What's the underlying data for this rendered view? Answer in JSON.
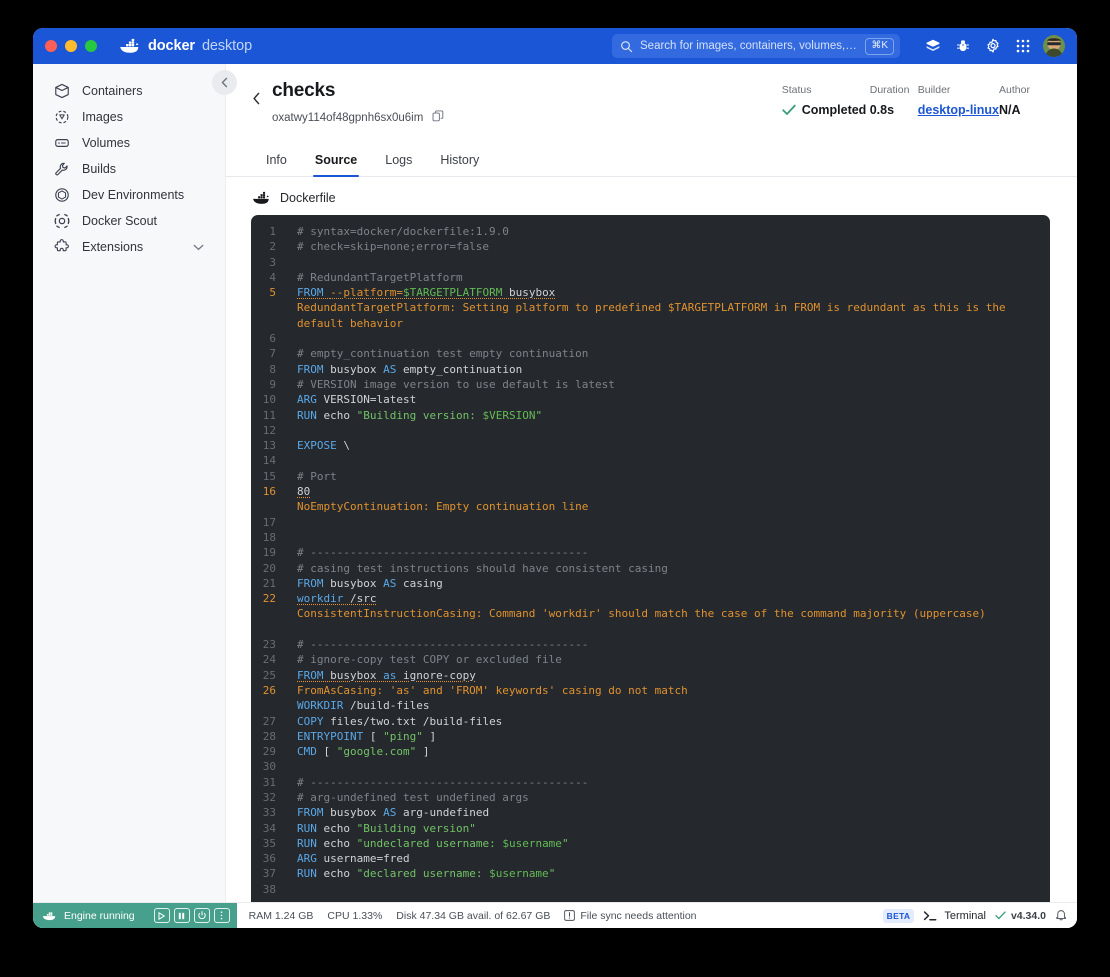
{
  "titlebar": {
    "brand_primary": "docker",
    "brand_secondary": "desktop",
    "search_placeholder": "Search for images, containers, volumes, extensi…",
    "search_shortcut": "⌘K",
    "icons": [
      "docker-scout-icon",
      "bug-icon",
      "gear-icon",
      "grid-apps-icon",
      "avatar"
    ]
  },
  "sidebar": {
    "items": [
      {
        "label": "Containers",
        "icon": "container-icon"
      },
      {
        "label": "Images",
        "icon": "image-icon"
      },
      {
        "label": "Volumes",
        "icon": "volume-icon"
      },
      {
        "label": "Builds",
        "icon": "wrench-icon"
      },
      {
        "label": "Dev Environments",
        "icon": "dev-env-icon"
      },
      {
        "label": "Docker Scout",
        "icon": "scout-icon"
      },
      {
        "label": "Extensions",
        "icon": "extensions-icon",
        "chevron": "chevron-down-icon"
      }
    ]
  },
  "header": {
    "title": "checks",
    "build_id": "oxatwy114of48gpnh6sx0u6im",
    "copy_icon": "copy-icon",
    "back_icon": "chevron-left-icon",
    "meta": [
      {
        "label": "Status",
        "value": "Completed",
        "icon": "check-icon"
      },
      {
        "label": "Duration",
        "value": "0.8s"
      },
      {
        "label": "Builder",
        "value": "desktop-linux",
        "link": true
      },
      {
        "label": "Author",
        "value": "N/A"
      }
    ]
  },
  "tabs": [
    {
      "label": "Info",
      "active": false
    },
    {
      "label": "Source",
      "active": true
    },
    {
      "label": "Logs",
      "active": false
    },
    {
      "label": "History",
      "active": false
    }
  ],
  "file": {
    "icon": "docker-whale-icon",
    "name": "Dockerfile"
  },
  "code": {
    "lines": [
      {
        "n": "1",
        "warn": false,
        "tokens": [
          {
            "t": "# syntax=docker/dockerfile:1.9.0",
            "c": "cmt"
          }
        ]
      },
      {
        "n": "2",
        "warn": false,
        "tokens": [
          {
            "t": "# check=skip=none;error=false",
            "c": "cmt"
          }
        ]
      },
      {
        "n": "3",
        "warn": false,
        "tokens": []
      },
      {
        "n": "4",
        "warn": false,
        "tokens": [
          {
            "t": "# RedundantTargetPlatform",
            "c": "cmt"
          }
        ]
      },
      {
        "n": "5",
        "warn": true,
        "squiggle": true,
        "tokens": [
          {
            "t": "FROM",
            "c": "kw"
          },
          {
            "t": " ",
            "c": "plain"
          },
          {
            "t": "--platform=",
            "c": "flag"
          },
          {
            "t": "$TARGETPLATFORM",
            "c": "var"
          },
          {
            "t": " busybox",
            "c": "plain"
          }
        ]
      },
      {
        "n": "",
        "warn": false,
        "diag": "RedundantTargetPlatform: Setting platform to predefined $TARGETPLATFORM in FROM is redundant as this is the default behavior"
      },
      {
        "n": "6",
        "warn": false,
        "tokens": []
      },
      {
        "n": "7",
        "warn": false,
        "tokens": [
          {
            "t": "# empty_continuation test empty continuation",
            "c": "cmt"
          }
        ]
      },
      {
        "n": "8",
        "warn": false,
        "tokens": [
          {
            "t": "FROM",
            "c": "kw"
          },
          {
            "t": " busybox ",
            "c": "plain"
          },
          {
            "t": "AS",
            "c": "kw"
          },
          {
            "t": " empty_continuation",
            "c": "plain"
          }
        ]
      },
      {
        "n": "9",
        "warn": false,
        "tokens": [
          {
            "t": "# VERSION image version to use default is latest",
            "c": "cmt"
          }
        ]
      },
      {
        "n": "10",
        "warn": false,
        "tokens": [
          {
            "t": "ARG",
            "c": "kw"
          },
          {
            "t": " VERSION=latest",
            "c": "plain"
          }
        ]
      },
      {
        "n": "11",
        "warn": false,
        "tokens": [
          {
            "t": "RUN",
            "c": "kw"
          },
          {
            "t": " echo ",
            "c": "plain"
          },
          {
            "t": "\"Building version: ",
            "c": "str"
          },
          {
            "t": "$VERSION",
            "c": "var"
          },
          {
            "t": "\"",
            "c": "str"
          }
        ]
      },
      {
        "n": "12",
        "warn": false,
        "tokens": []
      },
      {
        "n": "13",
        "warn": false,
        "tokens": [
          {
            "t": "EXPOSE",
            "c": "kw"
          },
          {
            "t": " \\",
            "c": "plain"
          }
        ]
      },
      {
        "n": "14",
        "warn": false,
        "tokens": []
      },
      {
        "n": "15",
        "warn": false,
        "tokens": [
          {
            "t": "# Port",
            "c": "cmt"
          }
        ]
      },
      {
        "n": "16",
        "warn": true,
        "squiggle": true,
        "tokens": [
          {
            "t": "80",
            "c": "plain"
          }
        ]
      },
      {
        "n": "",
        "warn": false,
        "diag": "NoEmptyContinuation: Empty continuation line"
      },
      {
        "n": "17",
        "warn": false,
        "tokens": []
      },
      {
        "n": "18",
        "warn": false,
        "tokens": []
      },
      {
        "n": "19",
        "warn": false,
        "tokens": [
          {
            "t": "# ------------------------------------------",
            "c": "cmt"
          }
        ]
      },
      {
        "n": "20",
        "warn": false,
        "tokens": [
          {
            "t": "# casing test instructions should have consistent casing",
            "c": "cmt"
          }
        ]
      },
      {
        "n": "21",
        "warn": false,
        "tokens": [
          {
            "t": "FROM",
            "c": "kw"
          },
          {
            "t": " busybox ",
            "c": "plain"
          },
          {
            "t": "AS",
            "c": "kw"
          },
          {
            "t": " casing",
            "c": "plain"
          }
        ]
      },
      {
        "n": "22",
        "warn": true,
        "squiggle": true,
        "tokens": [
          {
            "t": "workdir",
            "c": "kw"
          },
          {
            "t": " /src",
            "c": "plain"
          }
        ]
      },
      {
        "n": "",
        "warn": false,
        "diag": "ConsistentInstructionCasing: Command 'workdir' should match the case of the command majority (uppercase)"
      },
      {
        "n": "23",
        "warn": false,
        "tokens": []
      },
      {
        "n": "24",
        "warn": false,
        "tokens": [
          {
            "t": "# ------------------------------------------",
            "c": "cmt"
          }
        ]
      },
      {
        "n": "25",
        "warn": false,
        "tokens": [
          {
            "t": "# ignore-copy test COPY or excluded file",
            "c": "cmt"
          }
        ]
      },
      {
        "n": "26",
        "warn": true,
        "squiggle": true,
        "tokens": [
          {
            "t": "FROM",
            "c": "kw"
          },
          {
            "t": " busybox ",
            "c": "plain"
          },
          {
            "t": "as",
            "c": "kw"
          },
          {
            "t": " ignore-copy",
            "c": "plain"
          }
        ]
      },
      {
        "n": "",
        "warn": false,
        "diag": "FromAsCasing: 'as' and 'FROM' keywords' casing do not match"
      },
      {
        "n": "27",
        "warn": false,
        "tokens": [
          {
            "t": "WORKDIR",
            "c": "kw"
          },
          {
            "t": " /build-files",
            "c": "plain"
          }
        ]
      },
      {
        "n": "28",
        "warn": false,
        "tokens": [
          {
            "t": "COPY",
            "c": "kw"
          },
          {
            "t": " files/two.txt /build-files",
            "c": "plain"
          }
        ]
      },
      {
        "n": "29",
        "warn": false,
        "tokens": [
          {
            "t": "ENTRYPOINT",
            "c": "kw"
          },
          {
            "t": " [ ",
            "c": "plain"
          },
          {
            "t": "\"ping\"",
            "c": "str"
          },
          {
            "t": " ]",
            "c": "plain"
          }
        ]
      },
      {
        "n": "30",
        "warn": false,
        "tokens": [
          {
            "t": "CMD",
            "c": "kw"
          },
          {
            "t": " [ ",
            "c": "plain"
          },
          {
            "t": "\"google.com\"",
            "c": "str"
          },
          {
            "t": " ]",
            "c": "plain"
          }
        ]
      },
      {
        "n": "31",
        "warn": false,
        "tokens": []
      },
      {
        "n": "32",
        "warn": false,
        "tokens": [
          {
            "t": "# ------------------------------------------",
            "c": "cmt"
          }
        ]
      },
      {
        "n": "33",
        "warn": false,
        "tokens": [
          {
            "t": "# arg-undefined test undefined args",
            "c": "cmt"
          }
        ]
      },
      {
        "n": "34",
        "warn": false,
        "tokens": [
          {
            "t": "FROM",
            "c": "kw"
          },
          {
            "t": " busybox ",
            "c": "plain"
          },
          {
            "t": "AS",
            "c": "kw"
          },
          {
            "t": " arg-undefined",
            "c": "plain"
          }
        ]
      },
      {
        "n": "35",
        "warn": false,
        "tokens": [
          {
            "t": "RUN",
            "c": "kw"
          },
          {
            "t": " echo ",
            "c": "plain"
          },
          {
            "t": "\"Building version\"",
            "c": "str"
          }
        ]
      },
      {
        "n": "36",
        "warn": false,
        "tokens": [
          {
            "t": "RUN",
            "c": "kw"
          },
          {
            "t": " echo ",
            "c": "plain"
          },
          {
            "t": "\"undeclared username: ",
            "c": "str"
          },
          {
            "t": "$username",
            "c": "var"
          },
          {
            "t": "\"",
            "c": "str"
          }
        ]
      },
      {
        "n": "37",
        "warn": false,
        "tokens": [
          {
            "t": "ARG",
            "c": "kw"
          },
          {
            "t": " username=fred",
            "c": "plain"
          }
        ]
      },
      {
        "n": "38",
        "warn": false,
        "tokens": [
          {
            "t": "RUN",
            "c": "kw"
          },
          {
            "t": " echo ",
            "c": "plain"
          },
          {
            "t": "\"declared username: ",
            "c": "str"
          },
          {
            "t": "$username",
            "c": "var"
          },
          {
            "t": "\"",
            "c": "str"
          }
        ]
      }
    ]
  },
  "statusbar": {
    "engine_label": "Engine running",
    "engine_icon": "whale-icon",
    "controls": [
      "play-icon",
      "pause-icon",
      "power-icon",
      "kebab-icon"
    ],
    "ram": "RAM 1.24 GB",
    "cpu": "CPU 1.33%",
    "disk": "Disk 47.34 GB avail. of 62.67 GB",
    "file_sync": "File sync needs attention",
    "file_sync_icon": "alert-icon",
    "beta_badge": "BETA",
    "terminal_label": "Terminal",
    "terminal_icon": "terminal-prompt-icon",
    "version": "v4.34.0",
    "version_icon": "check-icon",
    "bell_icon": "bell-icon"
  },
  "colors": {
    "brand_blue": "#1b56d6",
    "engine_green": "#47a08b",
    "code_bg": "#25282c",
    "warn_orange": "#e0922f",
    "string_green": "#72c267",
    "keyword_blue": "#5aa8e8"
  }
}
